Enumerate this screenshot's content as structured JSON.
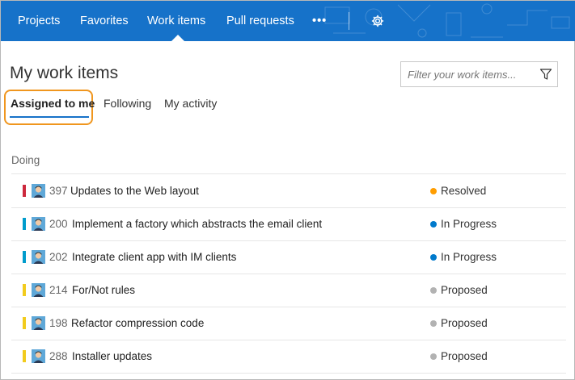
{
  "nav": {
    "items": [
      {
        "label": "Projects"
      },
      {
        "label": "Favorites"
      },
      {
        "label": "Work items"
      },
      {
        "label": "Pull requests"
      }
    ],
    "more_label": "•••",
    "settings_icon": "gear-icon",
    "color": "#1672c9"
  },
  "page": {
    "title": "My work items",
    "filter_placeholder": "Filter your work items...",
    "filter_icon": "funnel-icon"
  },
  "tabs": [
    {
      "label": "Assigned to me",
      "selected": true
    },
    {
      "label": "Following",
      "selected": false
    },
    {
      "label": "My activity",
      "selected": false
    }
  ],
  "group": {
    "label": "Doing"
  },
  "work_items": [
    {
      "id": "397",
      "title": "Updates to the Web layout",
      "state": "Resolved",
      "type_color": "#cc293d",
      "state_color": "#ff9d00"
    },
    {
      "id": "200",
      "title": "Implement a factory which abstracts the email client",
      "state": "In Progress",
      "type_color": "#009ccc",
      "state_color": "#007acc"
    },
    {
      "id": "202",
      "title": "Integrate client app with IM clients",
      "state": "In Progress",
      "type_color": "#009ccc",
      "state_color": "#007acc"
    },
    {
      "id": "214",
      "title": "For/Not rules",
      "state": "Proposed",
      "type_color": "#f2cb1d",
      "state_color": "#b2b2b2"
    },
    {
      "id": "198",
      "title": "Refactor compression code",
      "state": "Proposed",
      "type_color": "#f2cb1d",
      "state_color": "#b2b2b2"
    },
    {
      "id": "288",
      "title": "Installer updates",
      "state": "Proposed",
      "type_color": "#f2cb1d",
      "state_color": "#b2b2b2"
    }
  ],
  "colors": {
    "accent": "#1672c9",
    "highlight": "#f0961e"
  }
}
